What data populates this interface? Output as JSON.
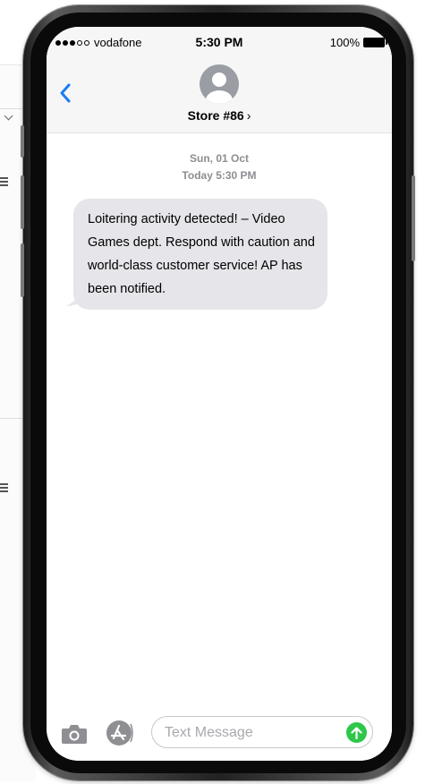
{
  "status_bar": {
    "carrier": "vodafone",
    "time": "5:30 PM",
    "battery": "100%"
  },
  "header": {
    "contact_name": "Store #86",
    "chevron": "›"
  },
  "thread": {
    "date_label": "Sun, 01 Oct",
    "time_label": "Today 5:30 PM",
    "messages": [
      {
        "direction": "incoming",
        "text": "Loitering activity detected! – Video Games dept. Respond with caution and world-class customer service! AP has been notified."
      }
    ]
  },
  "composer": {
    "placeholder": "Text Message",
    "value": ""
  },
  "icons": {
    "back": "chevron-left-icon",
    "avatar": "person-icon",
    "camera": "camera-icon",
    "apps": "app-store-icon",
    "send": "arrow-up-icon"
  },
  "colors": {
    "accent": "#1a7cf2",
    "bubble_incoming": "#e5e5ea",
    "send": "#2ec74a",
    "timestamp": "#8e8e93"
  }
}
